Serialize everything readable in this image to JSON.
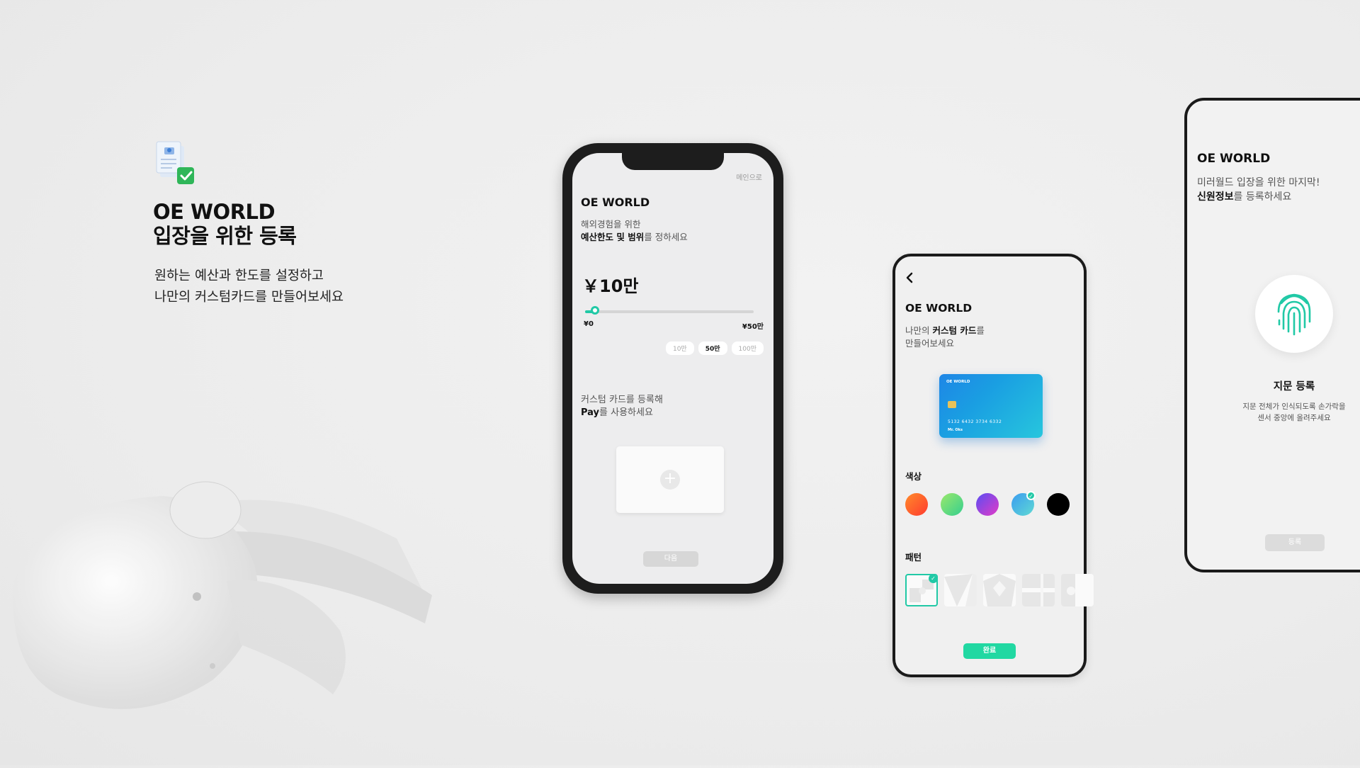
{
  "hero": {
    "icon": "document-check-icon",
    "title_line1": "OE WORLD",
    "title_line2": "입장을 위한 등록",
    "subtitle_line1": "원하는 예산과 한도를 설정하고",
    "subtitle_line2": "나만의 커스텀카드를 만들어보세요"
  },
  "phone_budget": {
    "skip_label": "메인으로",
    "brand": "OE WORLD",
    "desc_line1": "해외경험을 위한",
    "desc_bold": "예산한도 및 범위",
    "desc_rest": "를 정하세요",
    "amount": "￥10만",
    "slider": {
      "min_label": "¥0",
      "max_label": "¥50만",
      "min": 0,
      "max": 500000,
      "value": 100000
    },
    "chips": [
      {
        "label": "10만",
        "active": false
      },
      {
        "label": "50만",
        "active": true
      },
      {
        "label": "100만",
        "active": false
      }
    ],
    "prompt_line1": "커스텀 카드를 등록해",
    "prompt_bold": "Pay",
    "prompt_rest": "를 사용하세요",
    "add_icon": "plus-icon",
    "next_label": "다음"
  },
  "phone_card": {
    "back_icon": "chevron-left-icon",
    "brand": "OE WORLD",
    "desc_pre": "나만의 ",
    "desc_bold": "커스텀 카드",
    "desc_post": "를",
    "desc_line2": "만들어보세요",
    "card": {
      "brand": "OE WORLD",
      "number": "5132   6432   3734   6332",
      "holder": "Mr. Oks"
    },
    "color_label": "색상",
    "colors": [
      {
        "name": "orange-red",
        "from": "#ff8a2a",
        "to": "#ff3b2f",
        "selected": false
      },
      {
        "name": "green",
        "from": "#9be86b",
        "to": "#35cf8f",
        "selected": false
      },
      {
        "name": "purple",
        "from": "#5b4df2",
        "to": "#e23bc7",
        "selected": false
      },
      {
        "name": "sky",
        "from": "#3b9cf0",
        "to": "#5fd9d4",
        "selected": true
      },
      {
        "name": "black",
        "from": "#000000",
        "to": "#000000",
        "selected": false
      }
    ],
    "pattern_label": "패턴",
    "patterns": [
      "pattern-1",
      "pattern-2",
      "pattern-3",
      "pattern-4",
      "pattern-5"
    ],
    "selected_pattern": 0,
    "done_label": "완료"
  },
  "phone_fingerprint": {
    "brand": "OE WORLD",
    "desc_line1": "미러월드 입장을 위한 마지막!",
    "desc_bold": "신원정보",
    "desc_rest": "를 등록하세요",
    "fp_icon": "fingerprint-icon",
    "fp_title": "지문 등록",
    "fp_desc_line1": "지문 전체가 인식되도록 손가락을",
    "fp_desc_line2": "센서 중앙에 올려주세요",
    "button_label": "등록"
  },
  "colors": {
    "accent": "#21c9a6",
    "card_blue": "#1e86e6"
  }
}
